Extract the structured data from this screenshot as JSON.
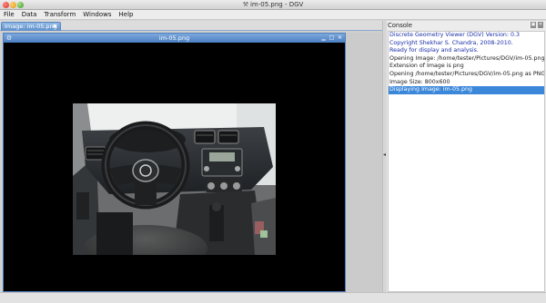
{
  "window": {
    "title": "im-05.png - DGV",
    "app_icon": "wrench-icon"
  },
  "menu": [
    "File",
    "Data",
    "Transform",
    "Windows",
    "Help"
  ],
  "tabs": [
    {
      "label": "Image: im-05.png",
      "close": "✖"
    }
  ],
  "image_window": {
    "title": "im-05.png",
    "buttons": [
      "▁",
      "□",
      "✕"
    ]
  },
  "console": {
    "title": "Console",
    "lines": [
      {
        "text": "Discrete Geometry Viewer (DGV) Version: 0.3",
        "style": "info"
      },
      {
        "text": "Copyright Shekhar S. Chandra, 2008-2010.",
        "style": "info"
      },
      {
        "text": "Ready for display and analysis.",
        "style": "info"
      },
      {
        "text": "Opening Image: /home/tester/Pictures/DGV/im-05.png",
        "style": "normal"
      },
      {
        "text": "Extension of Image is png",
        "style": "normal"
      },
      {
        "text": "Opening /home/tester/Pictures/DGV/im-05.png as PNG File",
        "style": "normal"
      },
      {
        "text": "Image Size: 800x600",
        "style": "normal"
      },
      {
        "text": "Displaying Image: im-05.png",
        "style": "selected"
      }
    ]
  }
}
